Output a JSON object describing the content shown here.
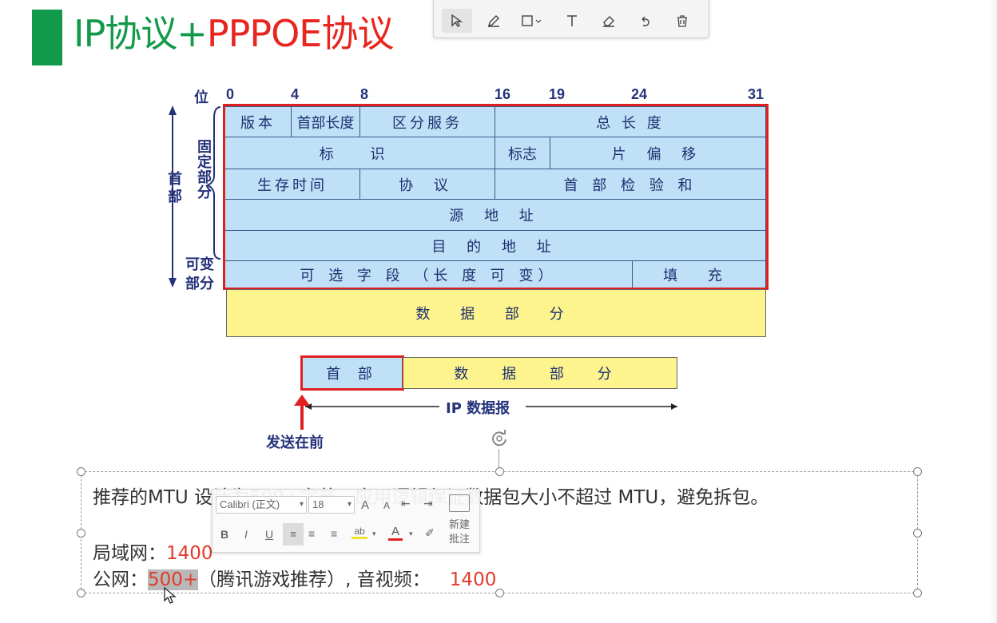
{
  "slide": {
    "title_green": "IP协议+",
    "title_red": "PPPOE协议",
    "accent_green": "#129a4a",
    "accent_red": "#e8251f"
  },
  "draw_toolbar": {
    "tools": [
      {
        "name": "select-icon",
        "glyph": "↖"
      },
      {
        "name": "pen-icon",
        "glyph": "✎"
      },
      {
        "name": "shape-icon",
        "glyph": "□⌄"
      },
      {
        "name": "text-icon",
        "glyph": "T"
      },
      {
        "name": "eraser-icon",
        "glyph": "⌫"
      },
      {
        "name": "undo-icon",
        "glyph": "↶"
      },
      {
        "name": "delete-icon",
        "glyph": "🗑"
      }
    ]
  },
  "diagram": {
    "bit_label": "位",
    "bits": [
      "0",
      "4",
      "8",
      "16",
      "19",
      "24",
      "31"
    ],
    "side_header": "首部",
    "side_fixed": "固定部分",
    "side_variable_1": "可变",
    "side_variable_2": "部分",
    "rows": {
      "version": "版本",
      "hdr_len": "首部长度",
      "dscp": "区分服务",
      "total_len": "总 长 度",
      "ident": "标 识",
      "flags": "标志",
      "frag_offset": "片 偏 移",
      "ttl": "生存时间",
      "protocol": "协 议",
      "checksum": "首 部 检 验 和",
      "src": "源 地 址",
      "dst": "目 的 地 址",
      "options": "可 选 字 段 （长 度 可 变）",
      "padding": "填 充"
    },
    "data_part": "数 据 部 分",
    "datagram_header": "首 部",
    "datagram_data": "数 据 部 分",
    "datagram_label": "IP 数据报",
    "send_first": "发送在前"
  },
  "textbox": {
    "line1": "推荐的MTU 设计为500+字节，应用逻辑保证数据包大小不超过 MTU，避免拆包。",
    "lan_label": "局域网：",
    "lan_value": "1400",
    "wan_label": "公网：",
    "wan_value": "500+",
    "wan_note": "（腾讯游戏推荐）, 音视频：",
    "av_value": "1400"
  },
  "mini_toolbar": {
    "font": "Calibri (正文)",
    "size": "18",
    "grow": "A",
    "shrink": "A",
    "bold": "B",
    "italic": "I",
    "underline": "U",
    "font_color": "A",
    "new_comment": "新建批注"
  }
}
